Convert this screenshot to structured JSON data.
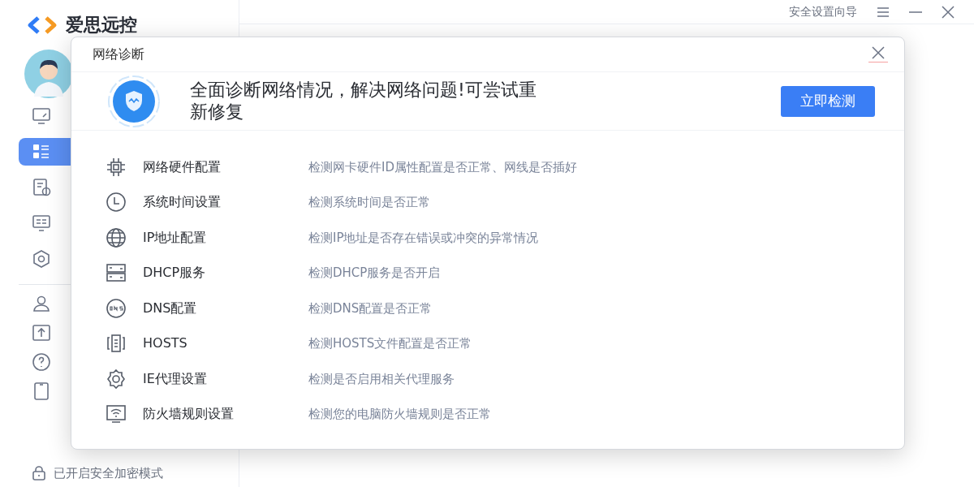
{
  "app": {
    "name": "爱思远控"
  },
  "top_bar": {
    "wizard_link": "安全设置向导"
  },
  "sidebar": {
    "main_items": [
      {
        "selected": false
      },
      {
        "selected": true
      },
      {
        "selected": false
      },
      {
        "selected": false
      },
      {
        "selected": false
      }
    ],
    "bottom_items": [
      {
        "selected": false
      },
      {
        "selected": false
      },
      {
        "selected": false
      },
      {
        "selected": false
      }
    ],
    "footer": "已开启安全加密模式"
  },
  "dialog": {
    "title": "网络诊断",
    "banner_text": "全面诊断网络情况，解决网络问题!可尝试重新修复",
    "action_button": "立即检测",
    "checks": [
      {
        "name": "网络硬件配置",
        "description": "检测网卡硬件ID属性配置是否正常、网线是否插好"
      },
      {
        "name": "系统时间设置",
        "description": "检测系统时间是否正常"
      },
      {
        "name": "IP地址配置",
        "description": "检测IP地址是否存在错误或冲突的异常情况"
      },
      {
        "name": "DHCP服务",
        "description": "检测DHCP服务是否开启"
      },
      {
        "name": "DNS配置",
        "description": "检测DNS配置是否正常"
      },
      {
        "name": "HOSTS",
        "description": "检测HOSTS文件配置是否正常"
      },
      {
        "name": "IE代理设置",
        "description": "检测是否启用相关代理服务"
      },
      {
        "name": "防火墙规则设置",
        "description": "检测您的电脑防火墙规则是否正常"
      }
    ]
  }
}
